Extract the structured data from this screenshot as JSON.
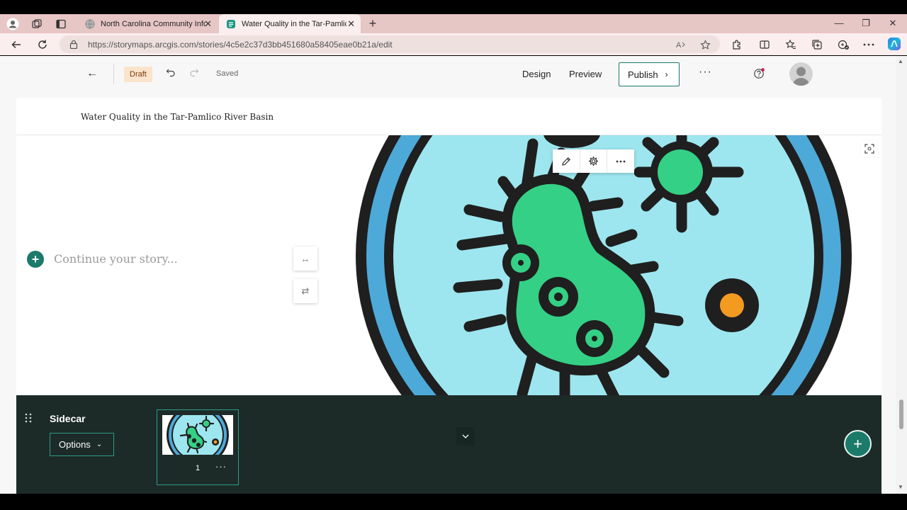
{
  "browser": {
    "tabs": [
      {
        "title": "North Carolina Community Infor",
        "active": false
      },
      {
        "title": "Water Quality in the Tar-Pamlico",
        "active": true
      }
    ],
    "new_tab": "+",
    "url": "https://storymaps.arcgis.com/stories/4c5e2c37d3bb451680a58405eae0b21a/edit",
    "window_controls": {
      "minimize": "—",
      "restore": "❐",
      "close": "✕"
    }
  },
  "app": {
    "back_glyph": "←",
    "status_badge": "Draft",
    "save_status": "Saved",
    "menu": {
      "design": "Design",
      "preview": "Preview",
      "publish": "Publish"
    },
    "more_glyph": "···"
  },
  "story": {
    "title": "Water Quality in the Tar-Pamlico River Basin",
    "placeholder": "Continue your story...",
    "add_glyph": "+",
    "side_buttons": [
      "↔",
      "⇄"
    ]
  },
  "sidecar": {
    "title": "Sidecar",
    "options_label": "Options",
    "slides": [
      {
        "number": "1",
        "more": "···"
      }
    ],
    "add_glyph": "+"
  },
  "colors": {
    "accent": "#1b7a6a",
    "sidecar_bg": "#1c2b28",
    "draft_bg": "#fbe3cc",
    "tab_strip": "#e7c6c6"
  },
  "icons": [
    "profile-icon",
    "workspaces-icon",
    "tab-actions-icon",
    "globe-favicon",
    "storymaps-favicon",
    "back-icon",
    "refresh-icon",
    "lock-icon",
    "read-aloud-icon",
    "favorite-icon",
    "extensions-icon",
    "split-screen-icon",
    "favorites-icon",
    "collections-icon",
    "browser-essentials-icon",
    "more-icon",
    "copilot-icon",
    "undo-icon",
    "redo-icon",
    "help-icon",
    "avatar-icon",
    "pencil-icon",
    "gear-icon",
    "expand-icon",
    "grip-icon",
    "chevron-down-icon"
  ]
}
